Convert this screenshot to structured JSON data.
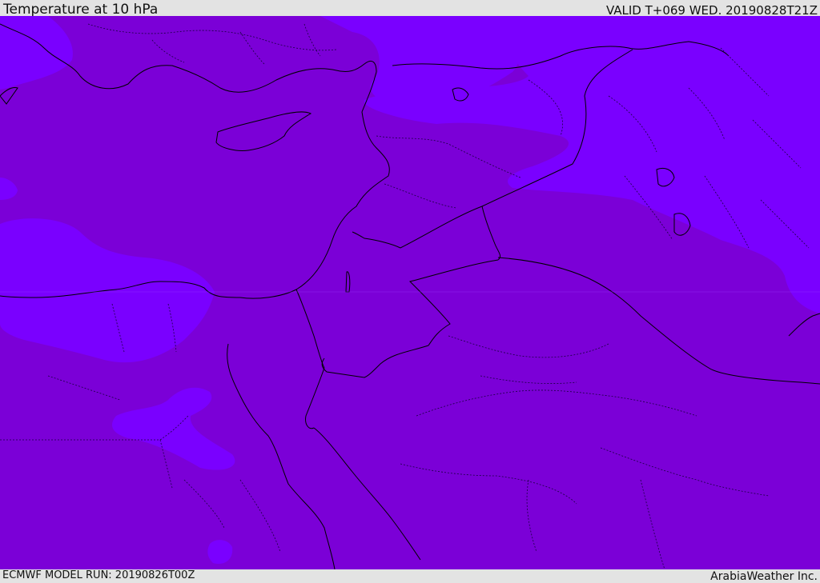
{
  "header": {
    "title": "Temperature at 10 hPa",
    "valid_time": "VALID T+069 WED. 20190828T21Z"
  },
  "footer": {
    "model_run": "ECMWF MODEL RUN: 20190826T00Z",
    "credit": "ArabiaWeather Inc."
  },
  "map": {
    "field": "temperature",
    "level": "10 hPa",
    "colors": {
      "warmer_field": "#7b00d7",
      "cooler_field": "#7a00ff",
      "coastline": "#000000",
      "borders": "#1a0040"
    }
  }
}
